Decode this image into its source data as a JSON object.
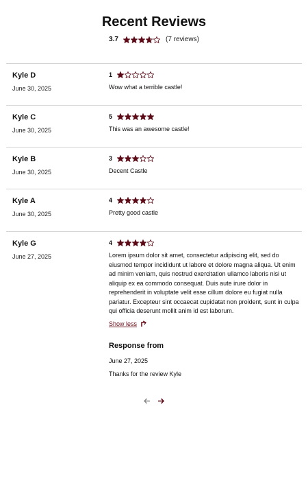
{
  "header": {
    "title": "Recent Reviews",
    "average": "3.7",
    "average_rating": 3.7,
    "count_text": "(7 reviews)"
  },
  "colors": {
    "star": "#5c0a16",
    "link": "#6a0f1c",
    "divider": "#d4d4d4",
    "pager_disabled": "#8a8a8a"
  },
  "reviews": [
    {
      "author": "Kyle D",
      "date": "June 30, 2025",
      "rating": 1,
      "rating_text": "1",
      "text": "Wow what a terrible castle!"
    },
    {
      "author": "Kyle C",
      "date": "June 30, 2025",
      "rating": 5,
      "rating_text": "5",
      "text": "This was an awesome castle!"
    },
    {
      "author": "Kyle B",
      "date": "June 30, 2025",
      "rating": 3,
      "rating_text": "3",
      "text": "Decent Castle"
    },
    {
      "author": "Kyle A",
      "date": "June 30, 2025",
      "rating": 4,
      "rating_text": "4",
      "text": "Pretty good castle"
    },
    {
      "author": "Kyle G",
      "date": "June 27, 2025",
      "rating": 4,
      "rating_text": "4",
      "text": "Lorem ipsum dolor sit amet, consectetur adipiscing elit, sed do eiusmod tempor incididunt ut labore et dolore magna aliqua. Ut enim ad minim veniam, quis nostrud exercitation ullamco laboris nisi ut aliquip ex ea commodo consequat. Duis aute irure dolor in reprehenderit in voluptate velit esse cillum dolore eu fugiat nulla pariatur. Excepteur sint occaecat cupidatat non proident, sunt in culpa qui officia deserunt mollit anim id est laborum.",
      "show_less": "Show less",
      "response": {
        "title": "Response from",
        "date": "June 27, 2025",
        "text": "Thanks for the review Kyle"
      }
    }
  ],
  "pagination": {
    "prev_icon": "arrow-left-icon",
    "next_icon": "arrow-right-icon",
    "prev_enabled": false,
    "next_enabled": true
  }
}
